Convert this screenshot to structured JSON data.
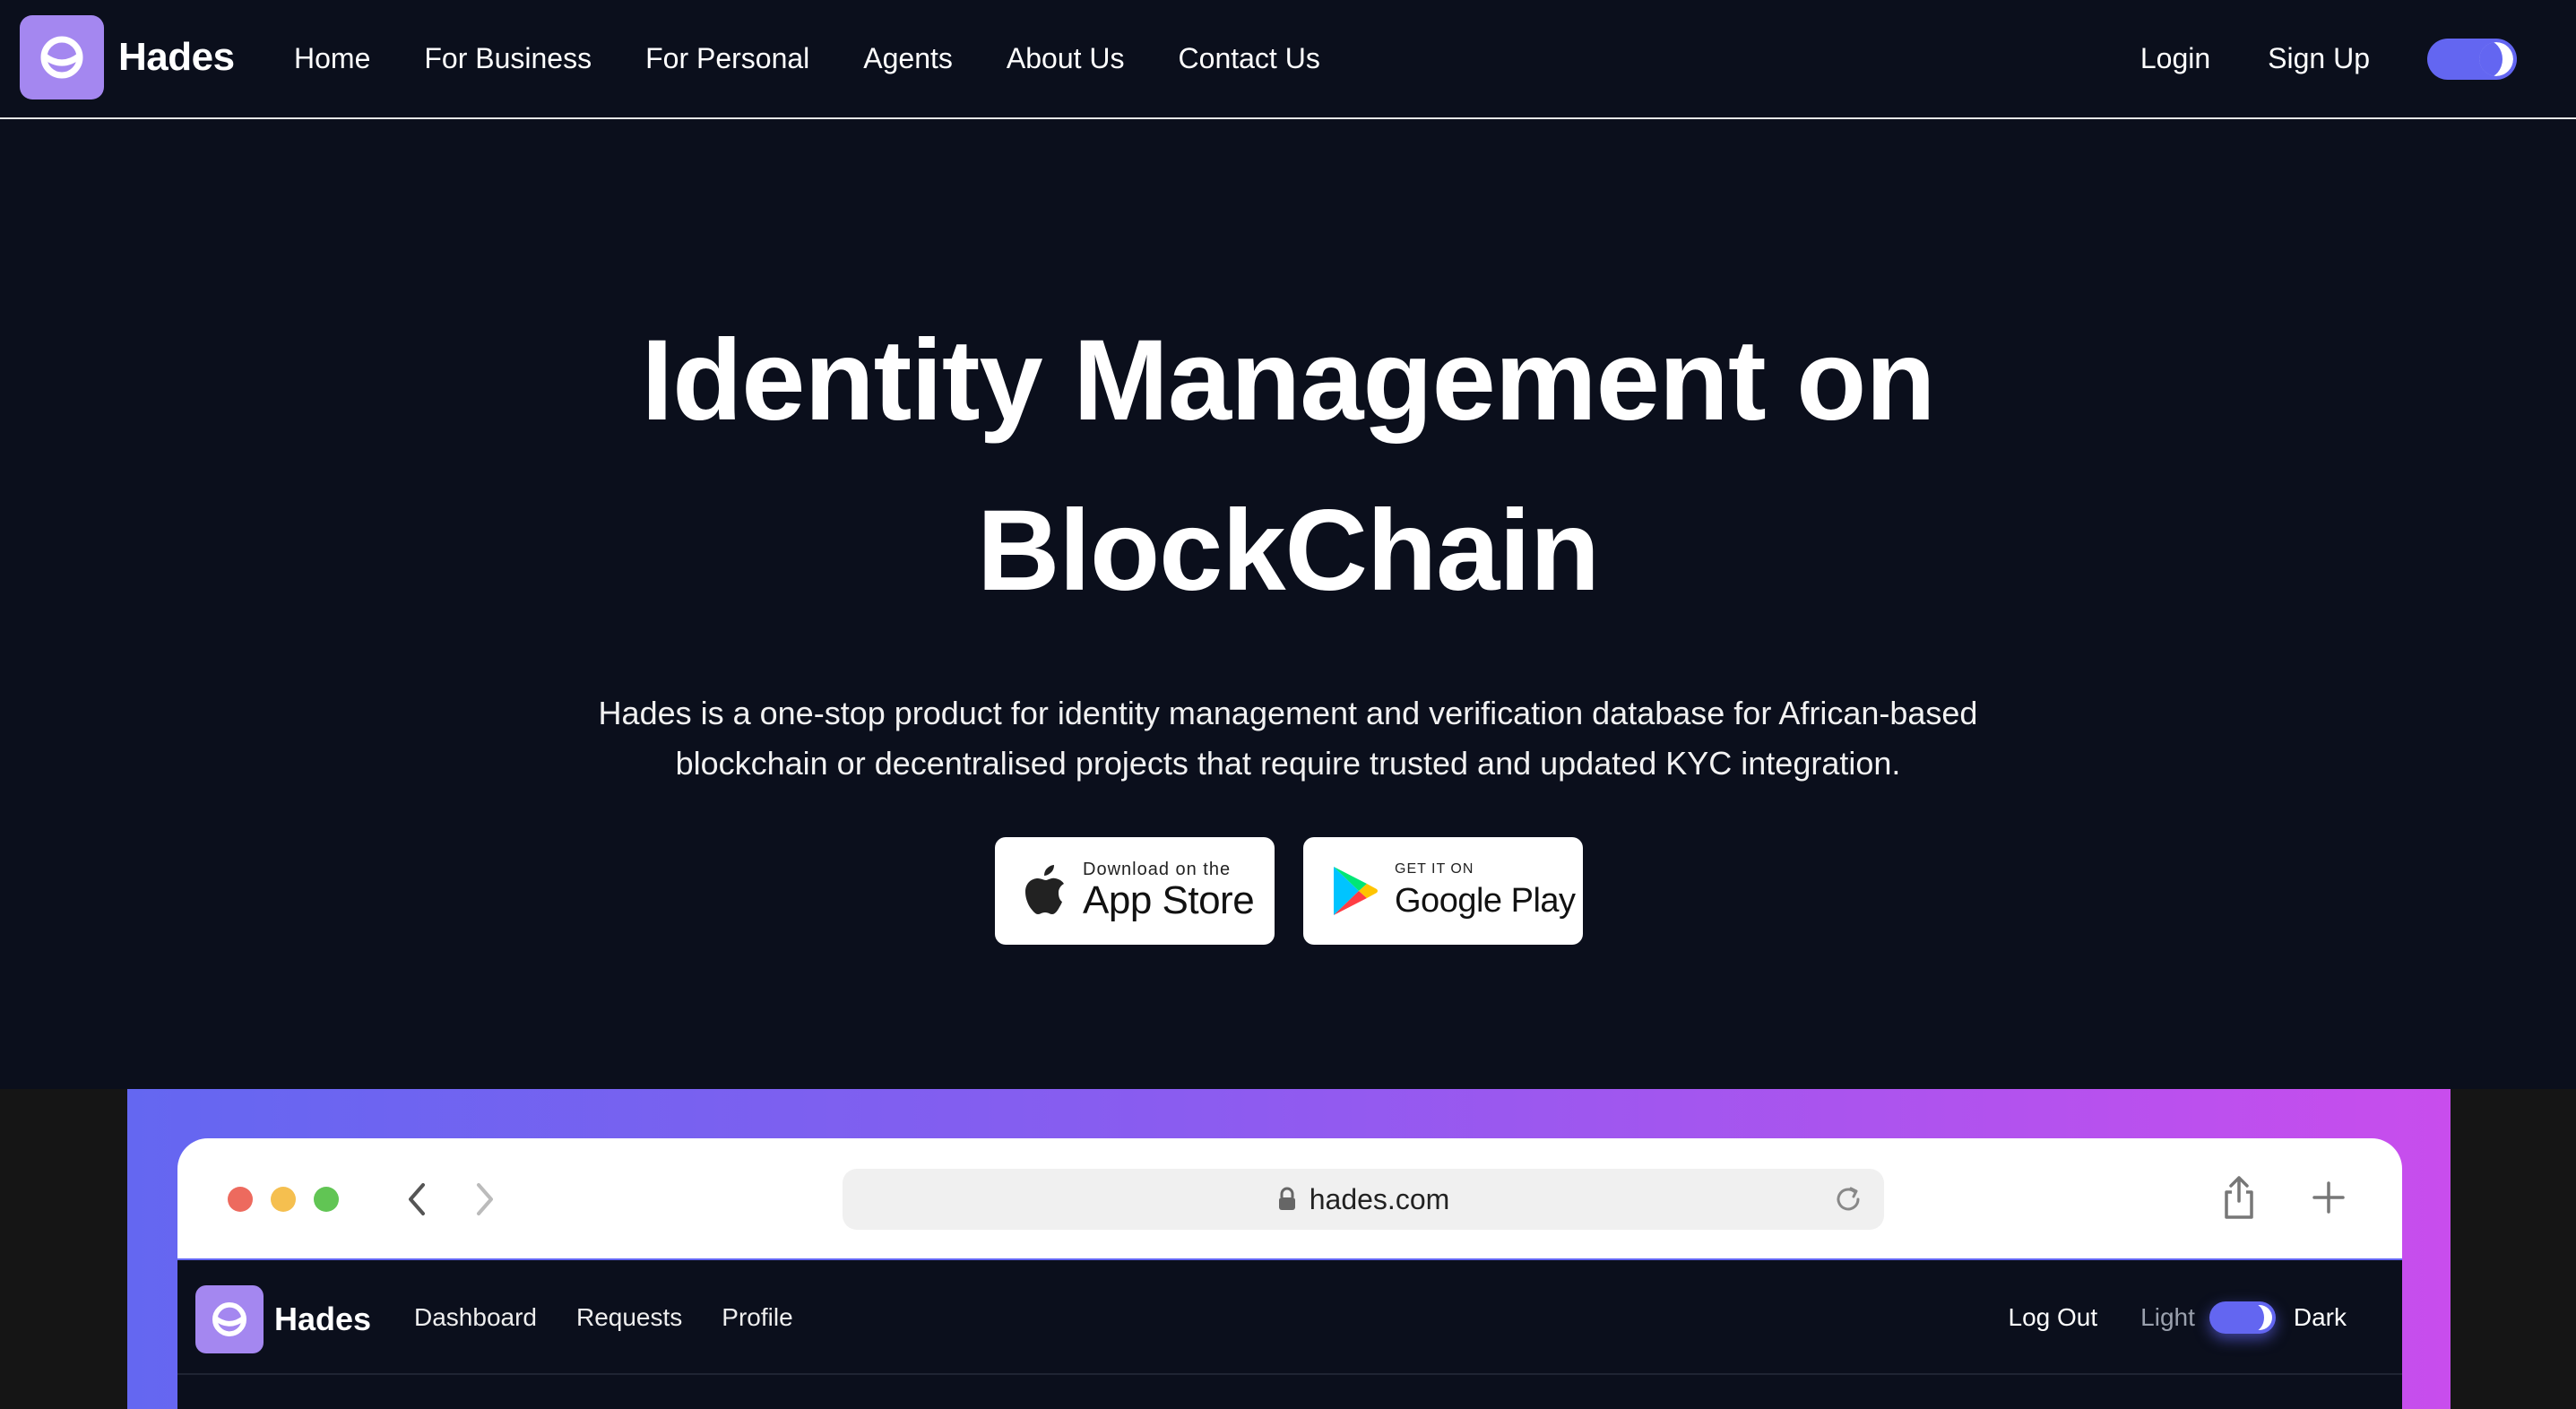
{
  "brand": {
    "name": "Hades",
    "logo_color": "#a487f0"
  },
  "nav": {
    "links": [
      "Home",
      "For Business",
      "For Personal",
      "Agents",
      "About Us",
      "Contact Us"
    ],
    "login": "Login",
    "signup": "Sign Up",
    "theme_toggle": {
      "state": "dark",
      "accent": "#6366f1"
    }
  },
  "hero": {
    "title_line1": "Identity Management on",
    "title_line2": "BlockChain",
    "subtitle_line1": "Hades is a one-stop product for identity management and verification database for African-based",
    "subtitle_line2": "blockchain or decentralised projects that require trusted and updated KYC integration."
  },
  "stores": {
    "app_store": {
      "small": "Download on the",
      "big": "App Store",
      "icon": "apple-icon"
    },
    "google_play": {
      "small": "GET IT ON",
      "big": "Google Play",
      "icon": "google-play-icon"
    }
  },
  "browser": {
    "url": "hades.com",
    "icons": [
      "lock-icon",
      "reload-icon",
      "share-icon",
      "plus-icon",
      "back-icon",
      "forward-icon"
    ]
  },
  "app_preview": {
    "brand": "Hades",
    "links": [
      "Dashboard",
      "Requests",
      "Profile"
    ],
    "logout": "Log Out",
    "light_label": "Light",
    "dark_label": "Dark"
  },
  "colors": {
    "background": "#0b0f1c",
    "gradient_start": "#6467f1",
    "gradient_end": "#c84ded"
  }
}
